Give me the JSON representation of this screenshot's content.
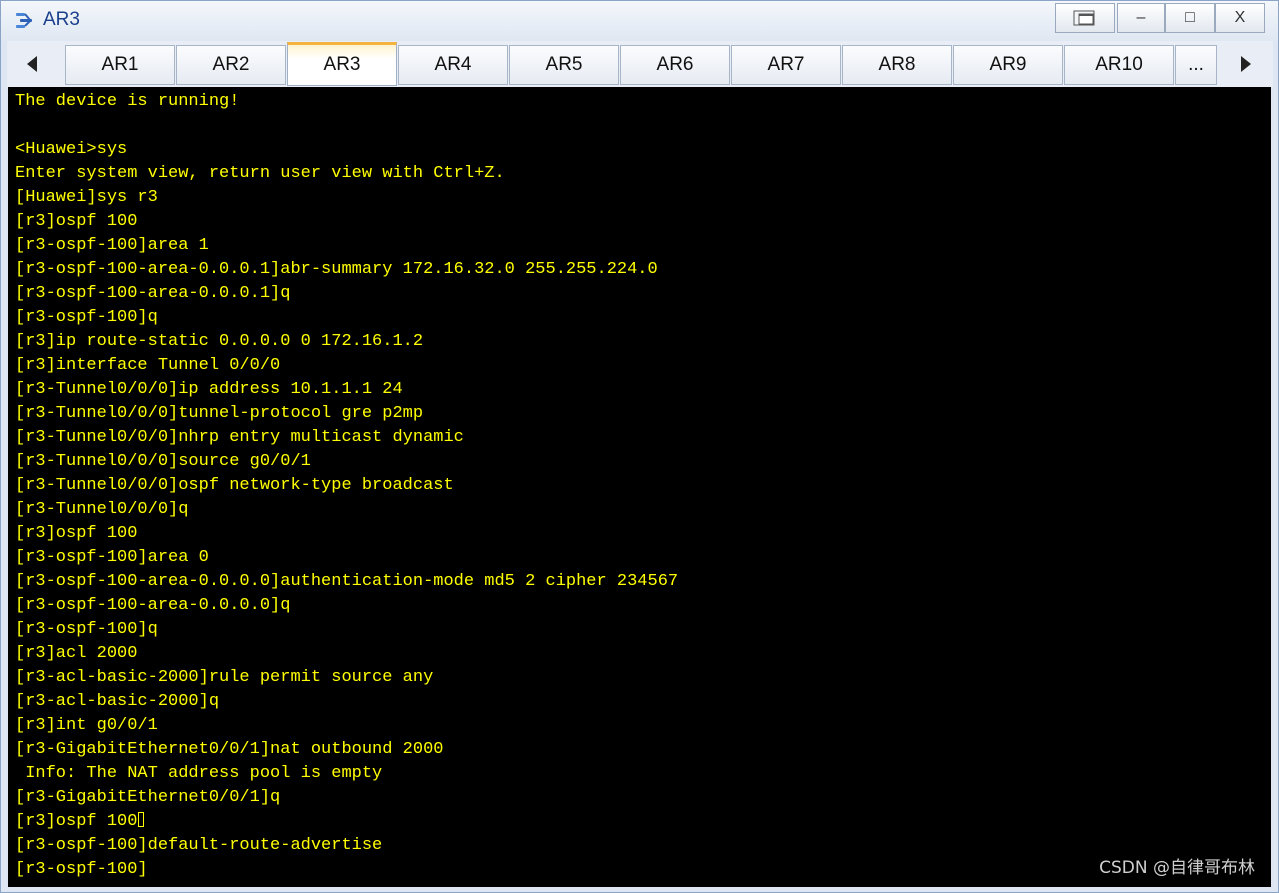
{
  "window": {
    "title": "AR3",
    "controls": {
      "restore_icon": "restore-icon",
      "minimize_label": "–",
      "maximize_label": "□",
      "close_label": "X"
    }
  },
  "tabs": {
    "items": [
      "AR1",
      "AR2",
      "AR3",
      "AR4",
      "AR5",
      "AR6",
      "AR7",
      "AR8",
      "AR9",
      "AR10",
      "..."
    ],
    "active": "AR3",
    "scroll_left_icon": "triangle-left-icon",
    "scroll_right_icon": "triangle-right-icon"
  },
  "terminal": {
    "text_color": "#ffff00",
    "background": "#000000",
    "lines": [
      "The device is running!",
      "",
      "<Huawei>sys",
      "Enter system view, return user view with Ctrl+Z.",
      "[Huawei]sys r3",
      "[r3]ospf 100",
      "[r3-ospf-100]area 1",
      "[r3-ospf-100-area-0.0.0.1]abr-summary 172.16.32.0 255.255.224.0",
      "[r3-ospf-100-area-0.0.0.1]q",
      "[r3-ospf-100]q",
      "[r3]ip route-static 0.0.0.0 0 172.16.1.2",
      "[r3]interface Tunnel 0/0/0",
      "[r3-Tunnel0/0/0]ip address 10.1.1.1 24",
      "[r3-Tunnel0/0/0]tunnel-protocol gre p2mp",
      "[r3-Tunnel0/0/0]nhrp entry multicast dynamic",
      "[r3-Tunnel0/0/0]source g0/0/1",
      "[r3-Tunnel0/0/0]ospf network-type broadcast",
      "[r3-Tunnel0/0/0]q",
      "[r3]ospf 100",
      "[r3-ospf-100]area 0",
      "[r3-ospf-100-area-0.0.0.0]authentication-mode md5 2 cipher 234567",
      "[r3-ospf-100-area-0.0.0.0]q",
      "[r3-ospf-100]q",
      "[r3]acl 2000",
      "[r3-acl-basic-2000]rule permit source any",
      "[r3-acl-basic-2000]q",
      "[r3]int g0/0/1",
      "[r3-GigabitEthernet0/0/1]nat outbound 2000",
      " Info: The NAT address pool is empty",
      "[r3-GigabitEthernet0/0/1]q",
      "[r3]ospf 100",
      "[r3-ospf-100]default-route-advertise",
      "[r3-ospf-100]"
    ],
    "cursor_line": 30
  },
  "watermark": "CSDN @自律哥布林"
}
